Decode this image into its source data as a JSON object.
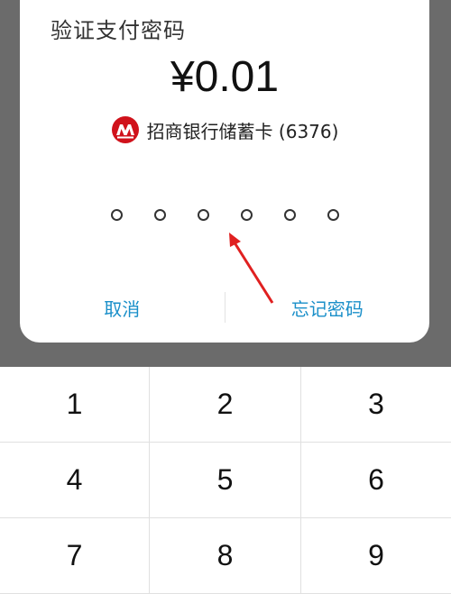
{
  "dialog": {
    "title": "验证支付密码",
    "amount": "¥0.01",
    "bank": {
      "name": "招商银行储蓄卡 (6376)",
      "logo_icon": "cmb-bank-logo-icon",
      "logo_color": "#d0121b"
    },
    "pin_length": 6,
    "cancel_label": "取消",
    "forgot_label": "忘记密码"
  },
  "keypad": {
    "keys": [
      "1",
      "2",
      "3",
      "4",
      "5",
      "6",
      "7",
      "8",
      "9"
    ]
  },
  "colors": {
    "accent": "#1a8fc9",
    "overlay": "#6b6b6b",
    "annotation_arrow": "#e02020"
  }
}
